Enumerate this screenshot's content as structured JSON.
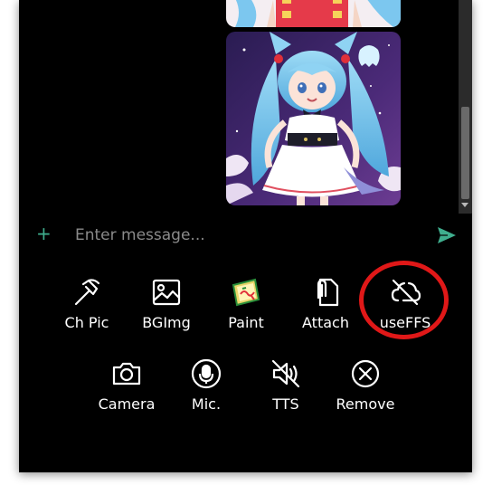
{
  "composer": {
    "plus_icon": "plus-icon",
    "placeholder": "Enter message...",
    "send_icon": "send-icon",
    "accent_color": "#3fae8e"
  },
  "toolbar": {
    "row1": [
      {
        "label": "Ch Pic",
        "icon": "hammer-icon"
      },
      {
        "label": "BGImg",
        "icon": "image-icon"
      },
      {
        "label": "Paint",
        "icon": "paint-icon"
      },
      {
        "label": "Attach",
        "icon": "attach-icon"
      },
      {
        "label": "useFFS",
        "icon": "cloud-off-icon"
      }
    ],
    "row2": [
      {
        "label": "Camera",
        "icon": "camera-icon"
      },
      {
        "label": "Mic.",
        "icon": "microphone-icon"
      },
      {
        "label": "TTS",
        "icon": "volume-mute-icon"
      },
      {
        "label": "Remove",
        "icon": "remove-icon"
      }
    ]
  },
  "annotation": {
    "highlight_color": "#e01818"
  }
}
